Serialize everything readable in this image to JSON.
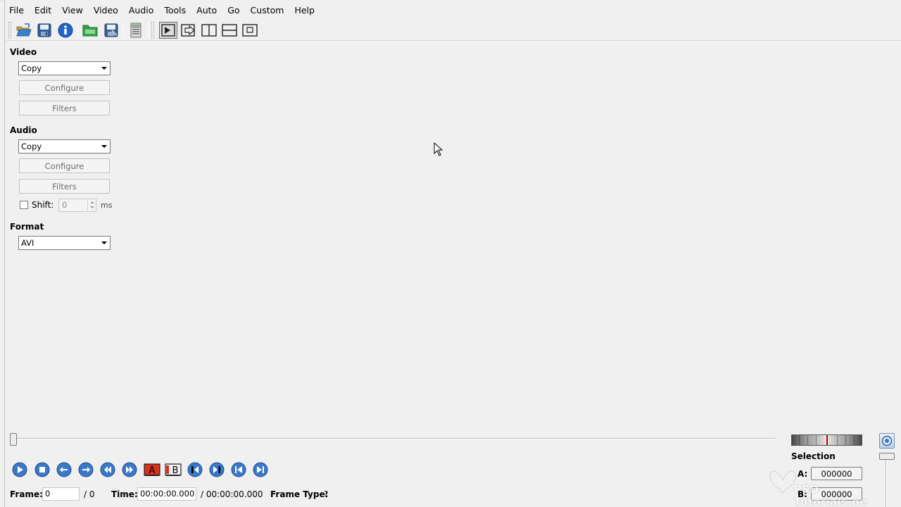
{
  "menu": [
    "File",
    "Edit",
    "View",
    "Video",
    "Audio",
    "Tools",
    "Auto",
    "Go",
    "Custom",
    "Help"
  ],
  "toolbar": {
    "icons": [
      "open-icon",
      "save-icon",
      "info-icon",
      "open-folder-icon",
      "save-as-icon",
      "calculator-icon",
      "input-view-icon",
      "output-view-icon",
      "side-by-side-icon",
      "top-bottom-icon",
      "single-view-icon"
    ]
  },
  "video": {
    "label": "Video",
    "codec": "Copy",
    "configure": "Configure",
    "filters": "Filters"
  },
  "audio": {
    "label": "Audio",
    "codec": "Copy",
    "configure": "Configure",
    "filters": "Filters",
    "shift_label": "Shift:",
    "shift_value": "0",
    "shift_unit": "ms",
    "shift_checked": false
  },
  "format": {
    "label": "Format",
    "value": "AVI"
  },
  "playback": {
    "marker_a": "A",
    "marker_b": "B"
  },
  "selection": {
    "title": "Selection",
    "a_label": "A:",
    "a_value": "000000",
    "b_label": "B:",
    "b_value": "000000"
  },
  "status": {
    "frame_label": "Frame:",
    "frame_value": "0",
    "frame_total": "/ 0",
    "time_label": "Time:",
    "time_value": "00:00:00.000",
    "time_total": "/ 00:00:00.000",
    "frame_type_label": "Frame Type:",
    "frame_type_value": "?"
  },
  "watermark": {
    "text": "PSD-Tutorials.de"
  },
  "colors": {
    "nav_button": "#3a78c8",
    "marker_a_bg": "#d83020",
    "jog_marker": "#c00000"
  }
}
